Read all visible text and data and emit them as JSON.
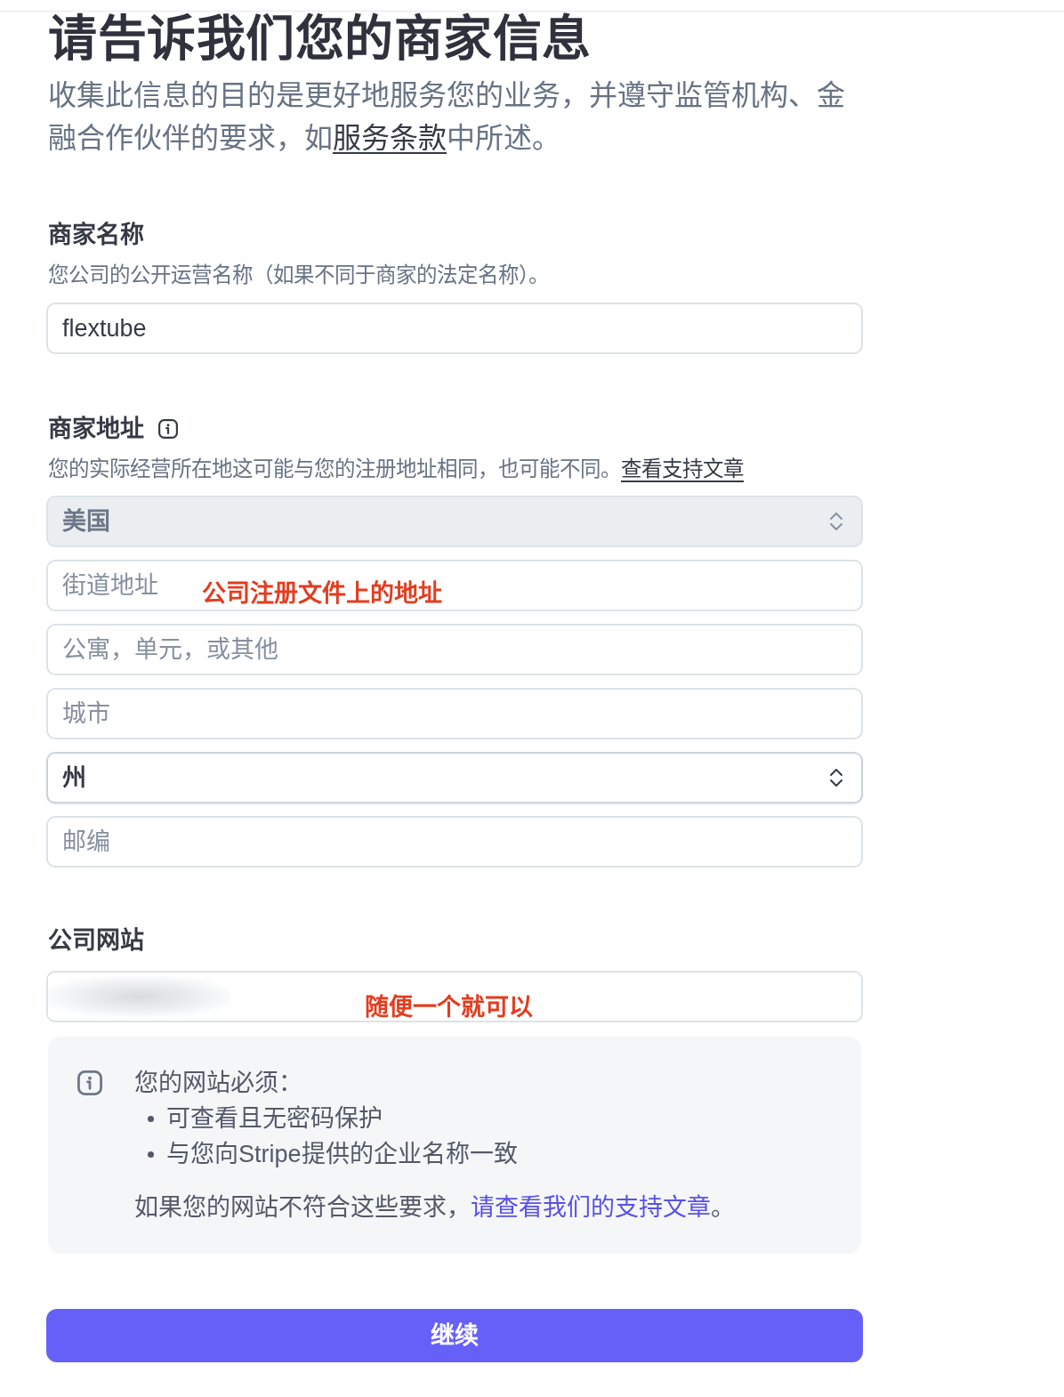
{
  "header": {
    "title": "请告诉我们您的商家信息",
    "intro": "收集此信息的目的是更好地服务您的业务，并遵守监管机构、金融合作伙伴的要求，如",
    "intro_link": "服务条款",
    "intro_end": "中所述。"
  },
  "business_name": {
    "label": "商家名称",
    "description": "您公司的公开运营名称（如果不同于商家的法定名称）。",
    "value": "flextube"
  },
  "business_address": {
    "label": "商家地址",
    "description": "您的实际经营所在地这可能与您的注册地址相同，也可能不同。",
    "description_link": "查看支持文章",
    "fields": [
      {
        "kind": "select",
        "value": "美国",
        "disabled": true
      },
      {
        "kind": "text",
        "placeholder": "街道地址",
        "annotation": "公司注册文件上的地址",
        "disabled": false
      },
      {
        "kind": "text",
        "placeholder": "公寓，单元，或其他",
        "disabled": false
      },
      {
        "kind": "text",
        "placeholder": "城市",
        "disabled": false
      },
      {
        "kind": "select",
        "value": "州",
        "disabled": false
      },
      {
        "kind": "text",
        "placeholder": "邮编",
        "disabled": false
      }
    ]
  },
  "website": {
    "label": "公司网站",
    "value_blurred": true,
    "annotation": "随便一个就可以",
    "notice": {
      "heading": "您的网站必须：",
      "requirements": [
        "可查看且无密码保护",
        "与您向Stripe提供的企业名称一致"
      ],
      "note": "如果您的网站不符合这些要求，",
      "note_link": "请查看我们的支持文章",
      "note_end": "。"
    }
  },
  "continue_button": {
    "label": "继续"
  }
}
